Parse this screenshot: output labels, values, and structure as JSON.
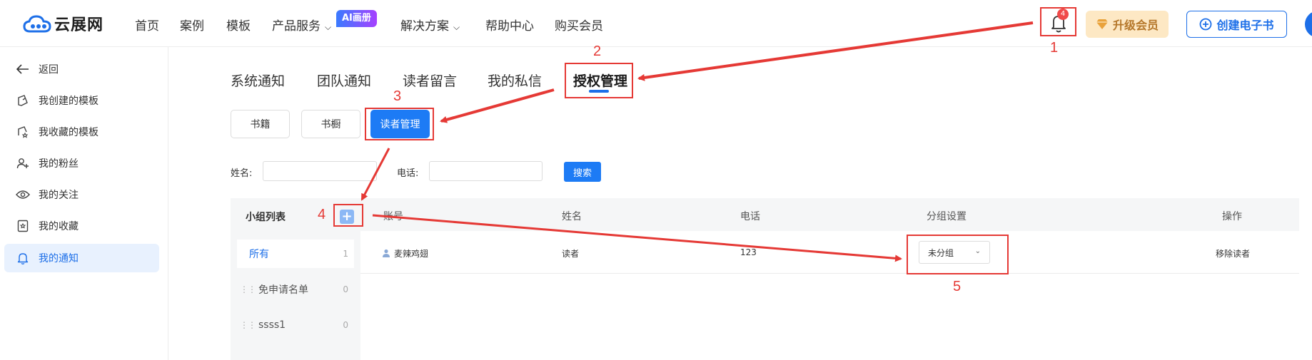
{
  "header": {
    "logo_text": "云展网",
    "nav": [
      {
        "label": "首页"
      },
      {
        "label": "案例"
      },
      {
        "label": "模板"
      },
      {
        "label": "产品服务"
      },
      {
        "label": "解决方案"
      },
      {
        "label": "帮助中心"
      },
      {
        "label": "购买会员"
      }
    ],
    "ai_badge": "AI画册",
    "notification_count": "4",
    "upgrade_label": "升级会员",
    "create_label": "创建电子书"
  },
  "sidebar": {
    "back_label": "返回",
    "items": [
      {
        "label": "我创建的模板"
      },
      {
        "label": "我收藏的模板"
      },
      {
        "label": "我的粉丝"
      },
      {
        "label": "我的关注"
      },
      {
        "label": "我的收藏"
      },
      {
        "label": "我的通知"
      }
    ]
  },
  "tabs": [
    {
      "label": "系统通知"
    },
    {
      "label": "团队通知"
    },
    {
      "label": "读者留言"
    },
    {
      "label": "我的私信"
    },
    {
      "label": "授权管理"
    }
  ],
  "subtabs": [
    {
      "label": "书籍"
    },
    {
      "label": "书橱"
    },
    {
      "label": "读者管理"
    }
  ],
  "filters": {
    "name_label": "姓名:",
    "name_value": "",
    "phone_label": "电话:",
    "phone_value": "",
    "search_label": "搜索"
  },
  "groups": {
    "title": "小组列表",
    "add_symbol": "+",
    "items": [
      {
        "label": "所有",
        "count": "1"
      },
      {
        "label": "免申请名单",
        "count": "0"
      },
      {
        "label": "ssss1",
        "count": "0"
      }
    ]
  },
  "table": {
    "columns": [
      "账号",
      "姓名",
      "电话",
      "分组设置",
      "操作"
    ],
    "rows": [
      {
        "account": "麦辣鸡翅",
        "name": "读者",
        "phone": "123",
        "group": "未分组",
        "action": "移除读者"
      }
    ]
  },
  "annotations": {
    "color": "#e53935",
    "steps": [
      "1",
      "2",
      "3",
      "4",
      "5"
    ]
  },
  "colors": {
    "accent": "#1d7bf5",
    "upgrade_bg": "#fde8c4",
    "upgrade_text": "#b5772a"
  }
}
